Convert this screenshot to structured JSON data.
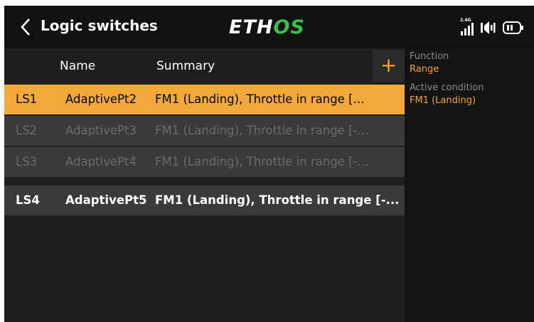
{
  "header": {
    "title": "Logic switches",
    "logo_left": "ETH",
    "logo_accent": "OS",
    "logo_right": "",
    "rf_label": "2.4G",
    "accent_color": "#f5a623",
    "logo_color": "#35c24b"
  },
  "table": {
    "columns": {
      "name": "Name",
      "summary": "Summary"
    },
    "add_label": "+",
    "rows": [
      {
        "id": "LS1",
        "name": "AdaptivePt2",
        "summary": "FM1 (Landing), Throttle in range [..."
      },
      {
        "id": "LS2",
        "name": "AdaptivePt3",
        "summary": "FM1 (Landing), Throttle in range [-..."
      },
      {
        "id": "LS3",
        "name": "AdaptivePt4",
        "summary": "FM1 (Landing), Throttle in range [-..."
      },
      {
        "id": "LS4",
        "name": "AdaptivePt5",
        "summary": "FM1 (Landing), Throttle in range [-..."
      }
    ]
  },
  "details": {
    "function_label": "Function",
    "function_value": "Range",
    "condition_label": "Active condition",
    "condition_value": "FM1 (Landing)"
  }
}
